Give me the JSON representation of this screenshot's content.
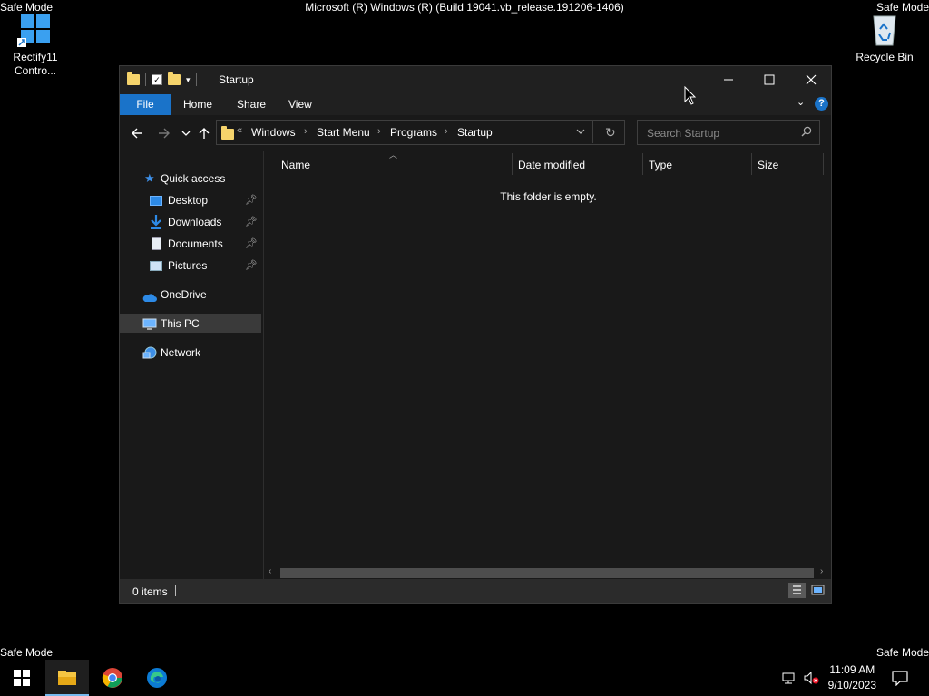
{
  "desktop": {
    "title": "Microsoft (R) Windows (R) (Build 19041.vb_release.191206-1406)",
    "safe_mode": "Safe Mode",
    "icons": [
      {
        "label": "Rectify11 Contro..."
      },
      {
        "label": "Recycle Bin"
      }
    ]
  },
  "window": {
    "title": "Startup",
    "ribbon_tabs": [
      "File",
      "Home",
      "Share",
      "View"
    ],
    "breadcrumb": [
      "Windows",
      "Start Menu",
      "Programs",
      "Startup"
    ],
    "breadcrumb_overflow": "«",
    "search_placeholder": "Search Startup",
    "nav": {
      "quick_access": "Quick access",
      "quick_items": [
        "Desktop",
        "Downloads",
        "Documents",
        "Pictures"
      ],
      "onedrive": "OneDrive",
      "this_pc": "This PC",
      "network": "Network"
    },
    "columns": [
      "Name",
      "Date modified",
      "Type",
      "Size"
    ],
    "empty_message": "This folder is empty.",
    "status": "0 items"
  },
  "taskbar": {
    "time": "11:09 AM",
    "date": "9/10/2023"
  },
  "colors": {
    "accent": "#1a73c9",
    "folder": "#f5d36b",
    "help": "#1a73c9"
  }
}
